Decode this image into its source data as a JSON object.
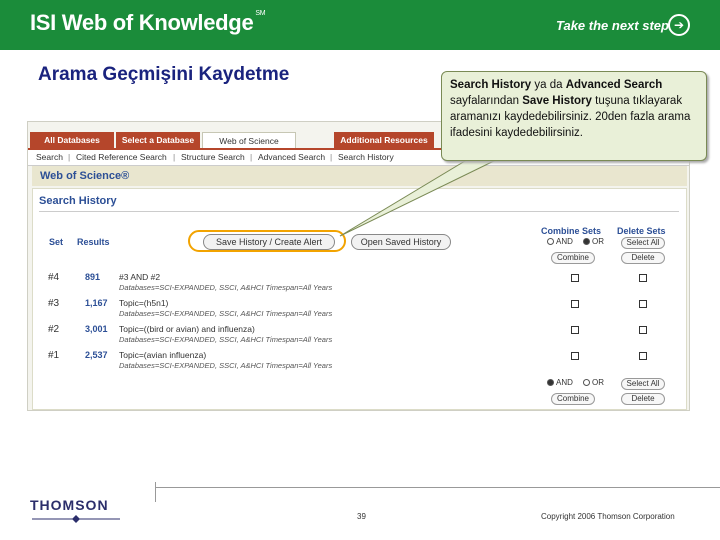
{
  "banner": {
    "title": "ISI Web of Knowledge",
    "title_mark": "SM",
    "tagline": "Take the next step",
    "color": "#1b8c3a"
  },
  "page_title": "Arama Geçmişini Kaydetme",
  "tabs": [
    {
      "label": "All Databases"
    },
    {
      "label": "Select a Database"
    },
    {
      "label": "Web of Science"
    },
    {
      "label": "Additional Resources"
    }
  ],
  "subnav": [
    "Search",
    "Cited Reference Search",
    "Structure Search",
    "Advanced Search",
    "Search History"
  ],
  "wos_title": "Web of Science®",
  "search_history": {
    "title": "Search History",
    "col_set": "Set",
    "col_results": "Results",
    "save_button": "Save History / Create Alert",
    "open_button": "Open Saved History",
    "combine_header": "Combine Sets",
    "delete_header": "Delete Sets",
    "and_label": "AND",
    "or_label": "OR",
    "combine_button": "Combine",
    "select_all_button": "Select All",
    "delete_button": "Delete",
    "rows": [
      {
        "set": "#4",
        "count": "891",
        "query": "#3 AND #2",
        "db": "Databases=SCI-EXPANDED, SSCI, A&HCI Timespan=All Years"
      },
      {
        "set": "#3",
        "count": "1,167",
        "query": "Topic=(h5n1)",
        "db": "Databases=SCI-EXPANDED, SSCI, A&HCI Timespan=All Years"
      },
      {
        "set": "#2",
        "count": "3,001",
        "query": "Topic=((bird or avian) and influenza)",
        "db": "Databases=SCI-EXPANDED, SSCI, A&HCI Timespan=All Years"
      },
      {
        "set": "#1",
        "count": "2,537",
        "query": "Topic=(avian influenza)",
        "db": "Databases=SCI-EXPANDED, SSCI, A&HCI Timespan=All Years"
      }
    ]
  },
  "callout": {
    "p1_b1": "Search History",
    "p1_t1": " ya da ",
    "p1_b2": "Advanced Search",
    "p1_t2": " sayfalarından ",
    "p1_b3": "Save History",
    "p1_t3": " tuşuna tıklayarak aramanızı kaydedebilirsiniz. 20den fazla arama ifadesini kaydedebilirsiniz."
  },
  "footer": {
    "logo": "THOMSON",
    "page_number": "39",
    "copyright": "Copyright 2006 Thomson Corporation"
  }
}
